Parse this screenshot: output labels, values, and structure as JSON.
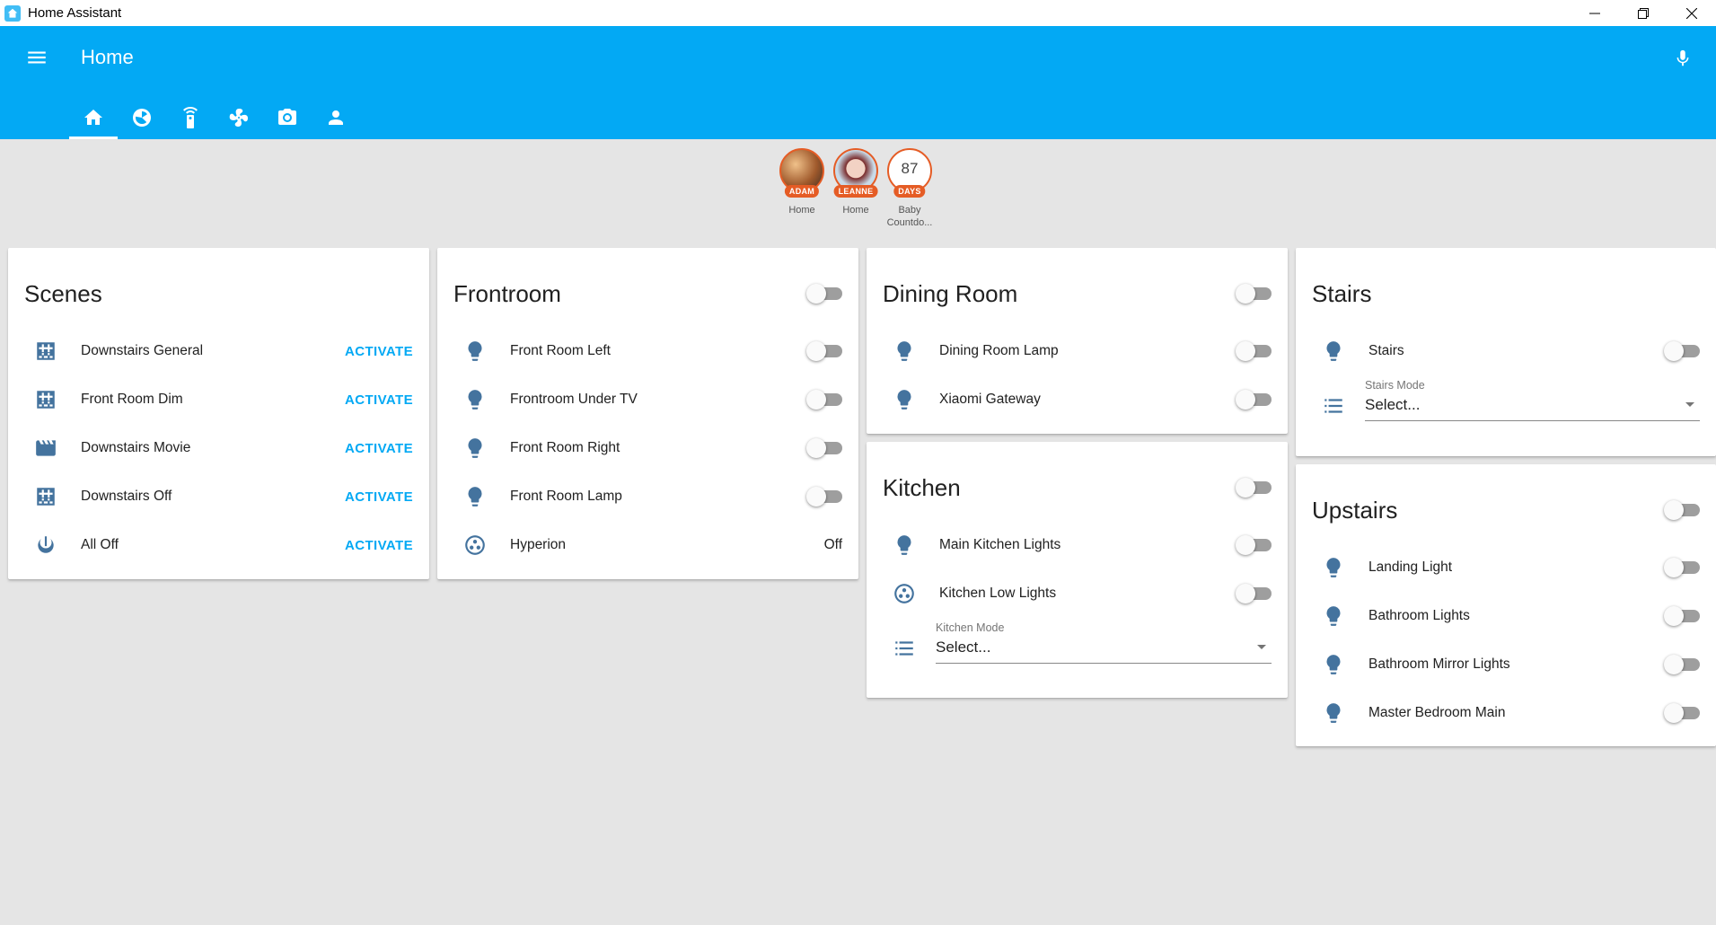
{
  "window": {
    "title": "Home Assistant"
  },
  "header": {
    "title": "Home",
    "tabs": [
      "home-icon",
      "scenes-icon",
      "remote-icon",
      "fan-icon",
      "camera-icon",
      "person-icon"
    ],
    "accent_color": "#03a9f4"
  },
  "badges": [
    {
      "name": "adam",
      "pill": "ADAM",
      "label": "Home"
    },
    {
      "name": "leanne",
      "pill": "LEANNE",
      "label": "Home"
    },
    {
      "name": "baby-countdown",
      "value": "87",
      "pill": "DAYS",
      "label": "Baby Countdo..."
    }
  ],
  "cards": {
    "scenes": {
      "title": "Scenes",
      "rows": [
        {
          "label": "Downstairs General",
          "action": "ACTIVATE",
          "icon": "scene-icon"
        },
        {
          "label": "Front Room Dim",
          "action": "ACTIVATE",
          "icon": "scene-icon"
        },
        {
          "label": "Downstairs Movie",
          "action": "ACTIVATE",
          "icon": "movie-icon"
        },
        {
          "label": "Downstairs Off",
          "action": "ACTIVATE",
          "icon": "scene-icon"
        },
        {
          "label": "All Off",
          "action": "ACTIVATE",
          "icon": "power-icon"
        }
      ]
    },
    "frontroom": {
      "title": "Frontroom",
      "rows": [
        {
          "label": "Front Room Left",
          "state": "off"
        },
        {
          "label": "Frontroom Under TV",
          "state": "off"
        },
        {
          "label": "Front Room Right",
          "state": "off"
        },
        {
          "label": "Front Room Lamp",
          "state": "off"
        },
        {
          "label": "Hyperion",
          "state_text": "Off"
        }
      ]
    },
    "dining_room": {
      "title": "Dining Room",
      "rows": [
        {
          "label": "Dining Room Lamp",
          "state": "off"
        },
        {
          "label": "Xiaomi Gateway",
          "state": "off"
        }
      ]
    },
    "kitchen": {
      "title": "Kitchen",
      "rows": [
        {
          "label": "Main Kitchen Lights",
          "state": "off"
        },
        {
          "label": "Kitchen Low Lights",
          "state": "off"
        }
      ],
      "select": {
        "caption": "Kitchen Mode",
        "value": "Select..."
      }
    },
    "stairs": {
      "title": "Stairs",
      "rows": [
        {
          "label": "Stairs",
          "state": "off"
        }
      ],
      "select": {
        "caption": "Stairs Mode",
        "value": "Select..."
      }
    },
    "upstairs": {
      "title": "Upstairs",
      "rows": [
        {
          "label": "Landing Light",
          "state": "off"
        },
        {
          "label": "Bathroom Lights",
          "state": "off"
        },
        {
          "label": "Bathroom Mirror Lights",
          "state": "off"
        },
        {
          "label": "Master Bedroom Main",
          "state": "off"
        }
      ]
    }
  }
}
